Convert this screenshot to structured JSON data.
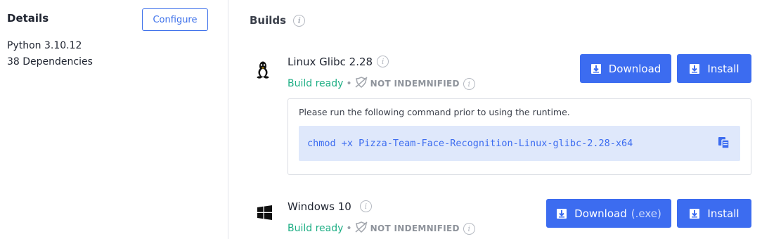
{
  "details": {
    "title": "Details",
    "configure_label": "Configure",
    "python_version": "Python 3.10.12",
    "dependencies": "38 Dependencies"
  },
  "builds": {
    "title": "Builds",
    "items": [
      {
        "os_icon": "linux-tux-icon",
        "name": "Linux Glibc 2.28",
        "status": "Build ready",
        "separator": "•",
        "indemnification": "NOT INDEMNIFIED",
        "download_label": "Download",
        "download_ext": "",
        "install_label": "Install",
        "command_note": "Please run the following command prior to using the runtime.",
        "command": "chmod +x Pizza-Team-Face-Recognition-Linux-glibc-2.28-x64"
      },
      {
        "os_icon": "windows-logo-icon",
        "name": "Windows 10",
        "status": "Build ready",
        "separator": "•",
        "indemnification": "NOT INDEMNIFIED",
        "download_label": "Download",
        "download_ext": "(.exe)",
        "install_label": "Install"
      }
    ]
  },
  "colors": {
    "accent": "#3c6cf0",
    "success": "#1dae84",
    "muted": "#8e939b",
    "code_bg": "#dfe8fb"
  }
}
